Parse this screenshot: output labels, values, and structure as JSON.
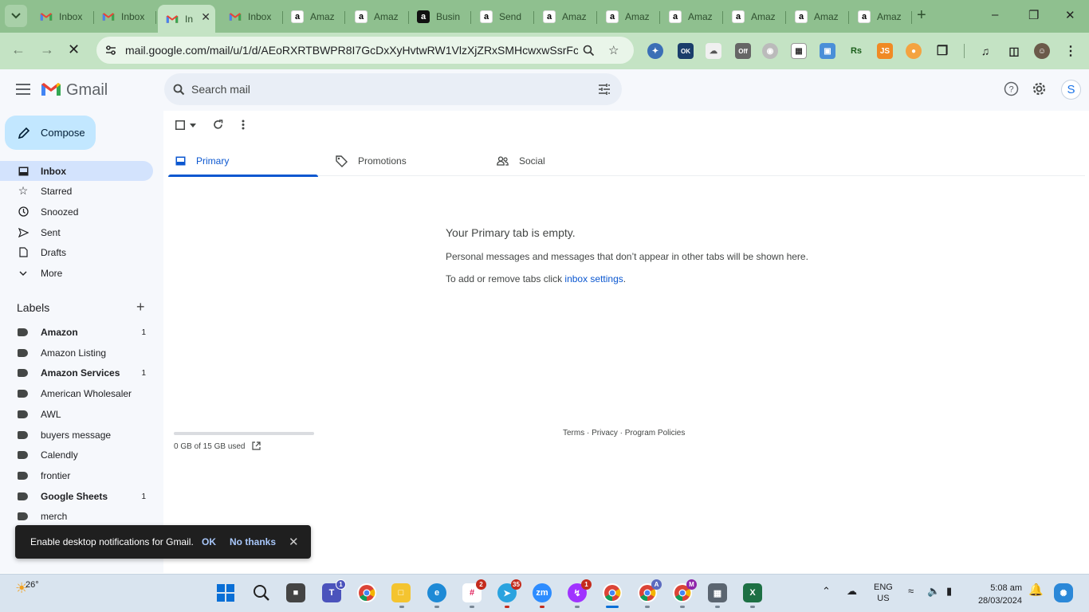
{
  "browser": {
    "tabs": [
      {
        "title": "Inbox",
        "favicon": "gmail-icon"
      },
      {
        "title": "Inbox",
        "favicon": "gmail-icon"
      },
      {
        "title": "Inbox",
        "favicon": "gmail-icon",
        "active": true,
        "shown_text": "In"
      },
      {
        "title": "Inbox",
        "favicon": "gmail-icon"
      },
      {
        "title": "Amaz",
        "favicon": "amazon-icon"
      },
      {
        "title": "Amaz",
        "favicon": "amazon-icon"
      },
      {
        "title": "Busin",
        "favicon": "business-icon"
      },
      {
        "title": "Send",
        "favicon": "amazon-icon"
      },
      {
        "title": "Amaz",
        "favicon": "amazon-icon"
      },
      {
        "title": "Amaz",
        "favicon": "amazon-icon"
      },
      {
        "title": "Amaz",
        "favicon": "amazon-icon"
      },
      {
        "title": "Amaz",
        "favicon": "amazon-icon"
      },
      {
        "title": "Amaz",
        "favicon": "amazon-icon"
      },
      {
        "title": "Amaz",
        "favicon": "amazon-icon"
      }
    ],
    "url": "mail.google.com/mail/u/1/d/AEoRXRTBWPR8I7GcDxXyHvtwRW1VlzXjZRxSMHcwxwSsrFcu...",
    "ext_badges": {
      "ok": "OK",
      "off": "Off",
      "rs": "Rs",
      "js": "JS"
    },
    "accent": "#8fc08f"
  },
  "gmail": {
    "logo_text": "Gmail",
    "search_placeholder": "Search mail",
    "avatar_letter": "S",
    "compose_label": "Compose",
    "nav": [
      {
        "label": "Inbox"
      },
      {
        "label": "Starred"
      },
      {
        "label": "Snoozed"
      },
      {
        "label": "Sent"
      },
      {
        "label": "Drafts"
      },
      {
        "label": "More"
      }
    ],
    "labels_heading": "Labels",
    "labels": [
      {
        "name": "Amazon",
        "count": "1"
      },
      {
        "name": "Amazon Listing",
        "count": ""
      },
      {
        "name": "Amazon Services",
        "count": "1"
      },
      {
        "name": "American Wholesaler",
        "count": ""
      },
      {
        "name": "AWL",
        "count": ""
      },
      {
        "name": "buyers message",
        "count": ""
      },
      {
        "name": "Calendly",
        "count": ""
      },
      {
        "name": "frontier",
        "count": ""
      },
      {
        "name": "Google Sheets",
        "count": "1"
      },
      {
        "name": "merch",
        "count": ""
      }
    ],
    "tabs": [
      {
        "label": "Primary"
      },
      {
        "label": "Promotions"
      },
      {
        "label": "Social"
      }
    ],
    "empty": {
      "title": "Your Primary tab is empty.",
      "line1": "Personal messages and messages that don’t appear in other tabs will be shown here.",
      "line2_prefix": "To add or remove tabs click ",
      "line2_link": "inbox settings",
      "line2_suffix": "."
    },
    "storage_text": "0 GB of 15 GB used",
    "footer": "Terms · Privacy · Program Policies",
    "snackbar": {
      "message": "Enable desktop notifications for Gmail.",
      "ok": "OK",
      "no_thanks": "No thanks"
    }
  },
  "taskbar": {
    "temperature": "26°",
    "badges": {
      "teams": "1",
      "slack": "2",
      "telegram": "35",
      "messenger": "1",
      "chrome_a": "A",
      "chrome_m": "M"
    },
    "zoom_label": "zm",
    "lang_top": "ENG",
    "lang_bottom": "US",
    "time": "5:08 am",
    "date": "28/03/2024"
  }
}
